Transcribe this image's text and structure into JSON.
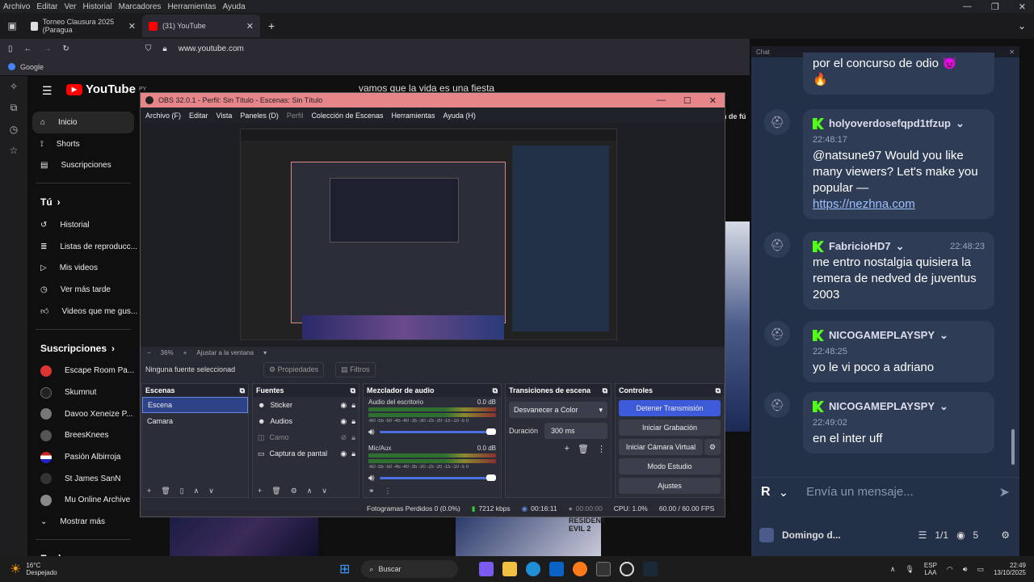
{
  "browser": {
    "menu": [
      "Archivo",
      "Editar",
      "Ver",
      "Historial",
      "Marcadores",
      "Herramientas",
      "Ayuda"
    ],
    "tabs": [
      {
        "title": "Torneo Clausura 2025 (Paragua"
      },
      {
        "title": "(31) YouTube"
      }
    ],
    "url": "www.youtube.com",
    "bookmark": "Google"
  },
  "youtube": {
    "logo": "YouTube",
    "region": "PY",
    "search_value": "vamos que la vida es una fiesta",
    "nav": [
      {
        "label": "Inicio",
        "icon": "home-icon"
      },
      {
        "label": "Shorts",
        "icon": "shorts-icon"
      },
      {
        "label": "Suscripciones",
        "icon": "subscriptions-icon"
      }
    ],
    "you_header": "Tú",
    "you_items": [
      "Historial",
      "Listas de reproducc...",
      "Mis videos",
      "Ver más tarde",
      "Videos que me gus..."
    ],
    "subs_header": "Suscripciones",
    "subs": [
      {
        "name": "Escape Room Pa...",
        "color": "#d33"
      },
      {
        "name": "Skumnut",
        "color": "#222"
      },
      {
        "name": "Davoo Xeneize P...",
        "color": "#777"
      },
      {
        "name": "BreesKnees",
        "color": "#555"
      },
      {
        "name": "Pasión Albirroja",
        "color": "#c22"
      },
      {
        "name": "St James SanN",
        "color": "#333"
      },
      {
        "name": "Mu Online Archive",
        "color": "#888"
      }
    ],
    "show_more": "Mostrar más",
    "explore": "Explorar",
    "partial_text": "n de fú",
    "video_label": "RESIDENT EVIL 2"
  },
  "obs": {
    "title": "OBS 32.0.1 - Perfil: Sin Título - Escenas: Sin Título",
    "menu": [
      "Archivo (F)",
      "Editar",
      "Vista",
      "Paneles (D)",
      "Perfil",
      "Colección de Escenas",
      "Herramientas",
      "Ayuda (H)"
    ],
    "zoom": "36%",
    "fit": "Ajustar a la ventana",
    "no_source": "Ninguna fuente seleccionad",
    "properties": "Propiedades",
    "filters": "Filtros",
    "scenes_title": "Escenas",
    "scenes": [
      "Escena",
      "Camara"
    ],
    "sources_title": "Fuentes",
    "sources": [
      "Sticker",
      "Audios",
      "Camo",
      "Captura de pantal"
    ],
    "mixer_title": "Mezclador de audio",
    "mixer": [
      {
        "name": "Audio del escritorio",
        "db": "0.0 dB"
      },
      {
        "name": "Mic/Aux",
        "db": "0.0 dB"
      }
    ],
    "meter_scale": "-60 -55 -50 -45 -40 -35 -30 -25 -20 -15 -10 -5 0",
    "transitions_title": "Transiciones de escena",
    "transition": "Desvanecer a Color",
    "duration_label": "Duración",
    "duration": "300 ms",
    "controls_title": "Controles",
    "controls": [
      "Detener Transmisión",
      "Iniciar Grabación",
      "Iniciar Cámara Virtual",
      "Modo Estudio",
      "Ajustes"
    ],
    "status": {
      "dropped": "Fotogramas Perdidos 0 (0.0%)",
      "bitrate": "7212 kbps",
      "live_time": "00:16:11",
      "rec_time": "00:00:00",
      "cpu": "CPU: 1.0%",
      "fps": "60.00 / 60.00 FPS"
    }
  },
  "chat": {
    "header": "Chat",
    "messages": [
      {
        "user": "",
        "time": "",
        "text": "por el concurso de odio 😈 🔥"
      },
      {
        "user": "holyoverdosefqpd1tfzup",
        "time": "22:48:17",
        "text": "@natsune97 Would you like many viewers? Let's make you popular —",
        "link": "https://nezhna.com"
      },
      {
        "user": "FabricioHD7",
        "time": "22:48:23",
        "text": "me entro nostalgia quisiera la remera de nedved de juventus 2003"
      },
      {
        "user": "NICOGAMEPLAYSPY",
        "time": "22:48:25",
        "text": "yo le vi poco a adriano"
      },
      {
        "user": "NICOGAMEPLAYSPY",
        "time": "22:49:02",
        "text": "en el inter uff"
      }
    ],
    "input_placeholder": "Envía un mensaje...",
    "channel": "Domingo d...",
    "count": "1/1",
    "viewers": "5",
    "avatar_letter": "R"
  },
  "taskbar": {
    "temp": "16°C",
    "weather": "Despejado",
    "search": "Buscar",
    "lang1": "ESP",
    "lang2": "LAA",
    "time": "22:49",
    "date": "13/10/2025"
  }
}
